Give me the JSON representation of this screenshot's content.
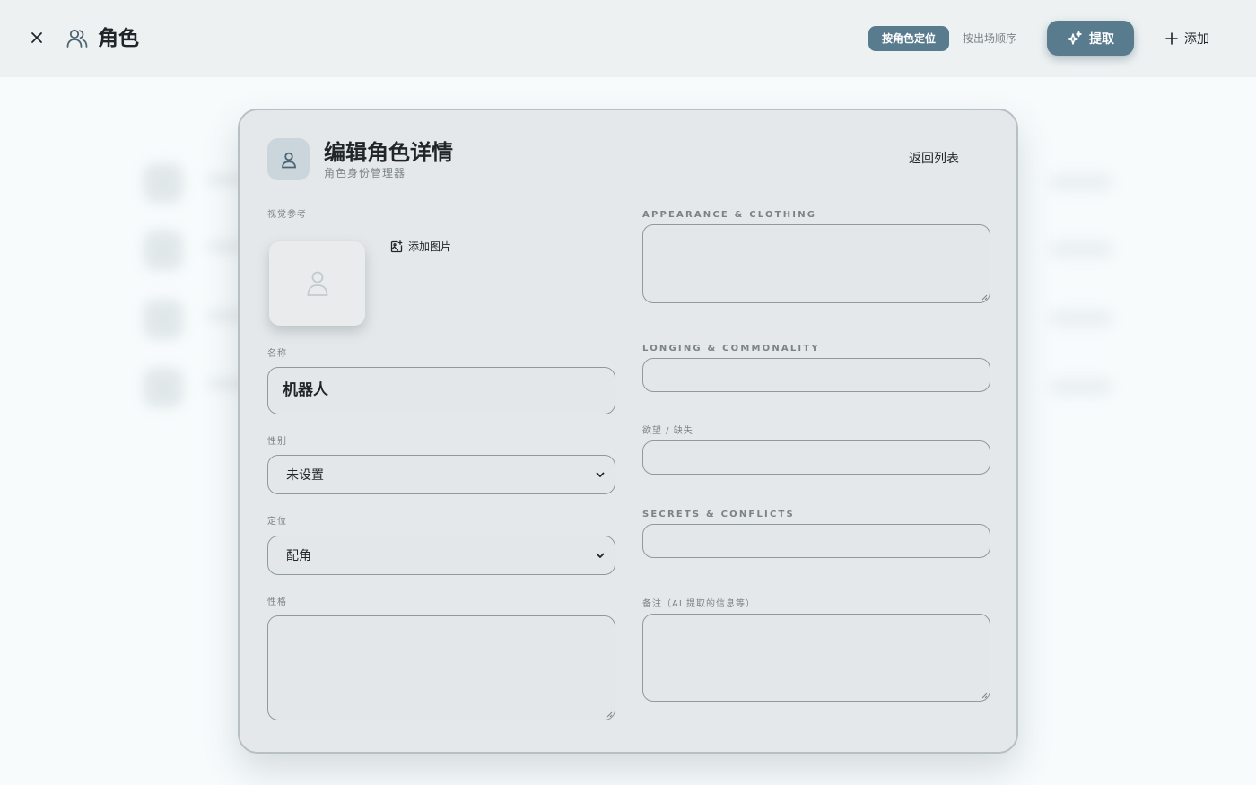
{
  "header": {
    "title": "角色",
    "sort_by_role": "按角色定位",
    "sort_by_appearance": "按出场顺序",
    "extract_label": "提取",
    "add_label": "添加"
  },
  "modal": {
    "title": "编辑角色详情",
    "subtitle": "角色身份管理器",
    "back_label": "返回列表",
    "visual_ref_label": "视觉参考",
    "add_image_label": "添加图片",
    "name_label": "名称",
    "name_value": "机器人",
    "gender_label": "性别",
    "gender_value": "未设置",
    "role_label": "定位",
    "role_value": "配角",
    "personality_label": "性格",
    "appearance_label": "APPEARANCE & CLOTHING",
    "longing_label": "LONGING & COMMONALITY",
    "desire_label": "欲望 / 缺失",
    "secrets_label": "SECRETS & CONFLICTS",
    "notes_label": "备注（AI 提取的信息等）"
  },
  "colors": {
    "accent": "#587b8d",
    "modal_bg": "#e5e8ea",
    "topbar_bg": "#edf1f2"
  }
}
